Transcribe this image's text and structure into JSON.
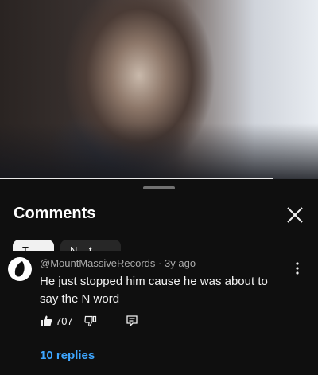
{
  "video": {
    "progress_fraction": 0.86
  },
  "comments_panel": {
    "title": "Comments",
    "sort_chips": [
      "T...",
      "N... t"
    ]
  },
  "comment": {
    "author": "@MountMassiveRecords",
    "separator": "·",
    "age": "3y ago",
    "text": "He just stopped him cause he was about to say the N word",
    "like_count": "707",
    "replies_label": "10 replies"
  },
  "icons": {
    "close": "close-icon",
    "more": "more-vert-icon",
    "like": "thumb-up-icon",
    "dislike": "thumb-down-icon",
    "reply": "reply-icon"
  },
  "colors": {
    "background": "#0f0f0f",
    "replies_link": "#3ea6ff",
    "meta_text": "#aaaaaa"
  }
}
